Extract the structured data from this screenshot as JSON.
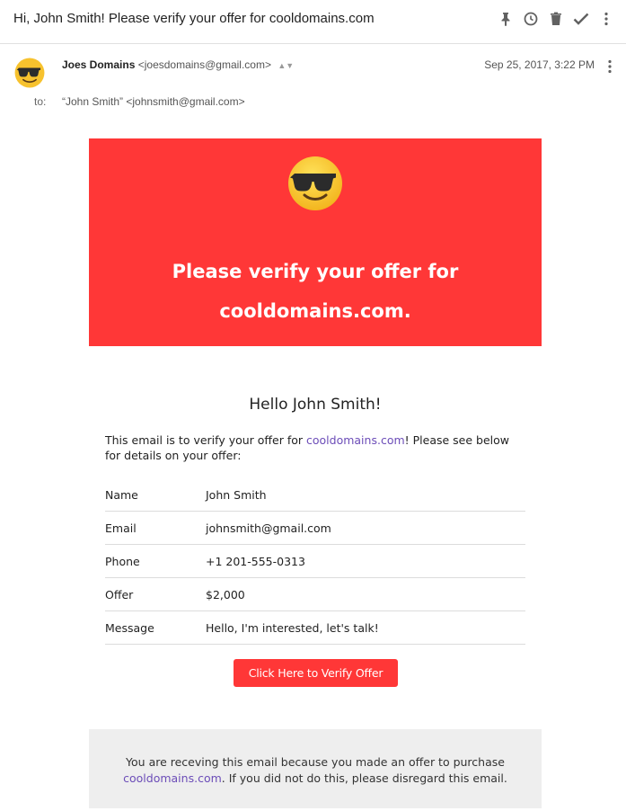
{
  "subject": "Hi, John Smith! Please verify your offer for cooldomains.com",
  "toolbar": {
    "icons": [
      "pin-icon",
      "clock-icon",
      "trash-icon",
      "check-icon",
      "more-vert-icon"
    ],
    "icon_color": "#616161"
  },
  "header": {
    "sender_name": "Joes Domains",
    "sender_email": "<joesdomains@gmail.com>",
    "date": "Sep 25, 2017, 3:22 PM",
    "to_label": "to:",
    "to_value": "“John Smith” <johnsmith@gmail.com>"
  },
  "banner": {
    "line1": "Please verify your offer for",
    "line2": "cooldomains.com.",
    "background": "#ff3737"
  },
  "body": {
    "greeting": "Hello John Smith!",
    "intro_before": "This email is to verify your offer for ",
    "intro_link": "cooldomains.com",
    "intro_after": "! Please see below for details on your offer:"
  },
  "details": [
    {
      "label": "Name",
      "value": "John Smith"
    },
    {
      "label": "Email",
      "value": "johnsmith@gmail.com"
    },
    {
      "label": "Phone",
      "value": "+1 201-555-0313"
    },
    {
      "label": "Offer",
      "value": "$2,000"
    },
    {
      "label": "Message",
      "value": "Hello, I'm interested, let's talk!"
    }
  ],
  "cta": {
    "label": "Click Here to Verify Offer"
  },
  "footer": {
    "text_before": "You are receving this email because you made an offer to purchase ",
    "link": "cooldomains.com",
    "text_after": ". If you did not do this, please disregard this email."
  },
  "colors": {
    "link": "#6c4db8",
    "phone_link": "#2a6bc1",
    "accent": "#ff3737",
    "footer_bg": "#eeeeee"
  }
}
